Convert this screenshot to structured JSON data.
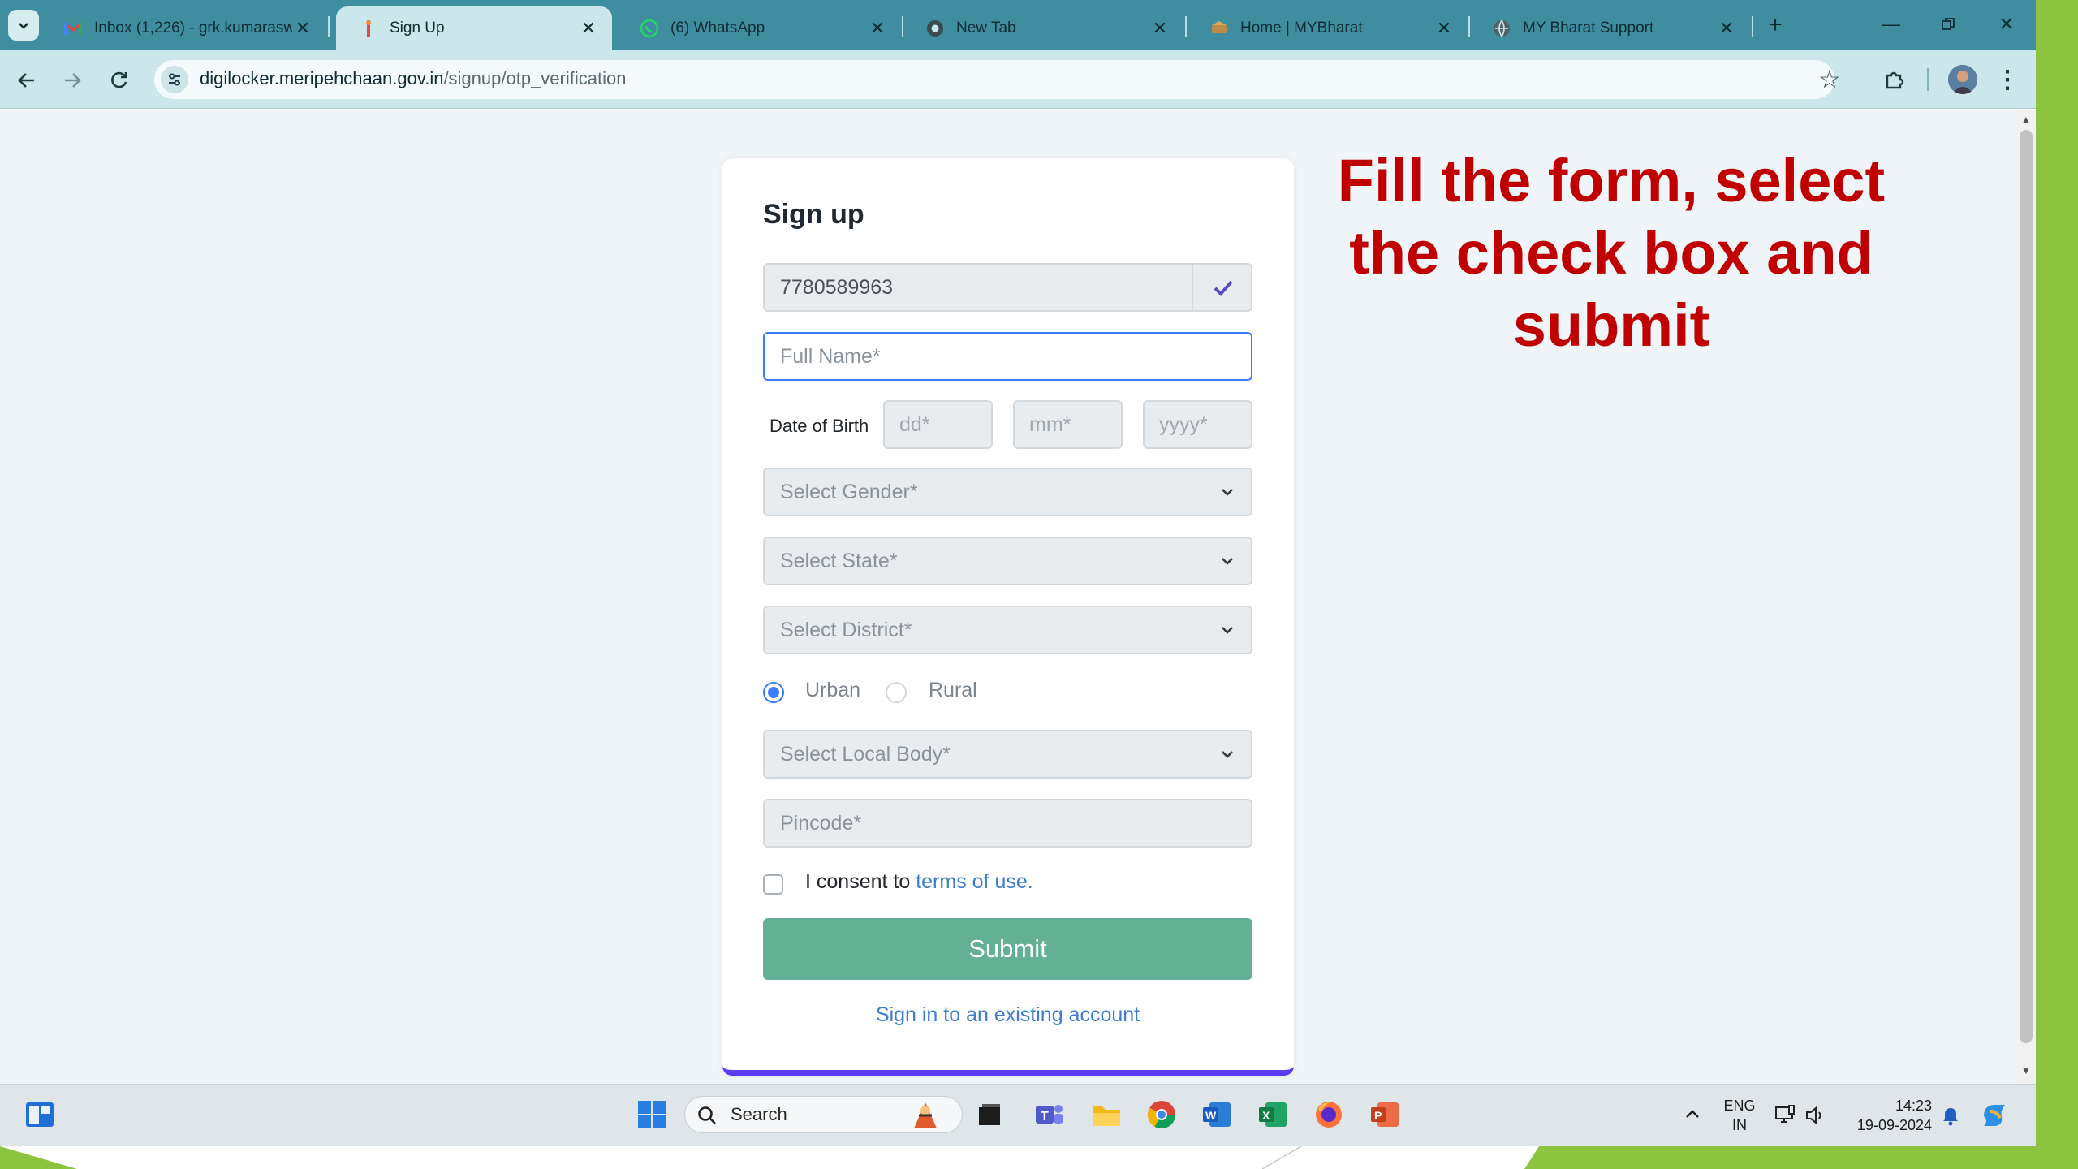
{
  "tabs": [
    {
      "title": "Inbox (1,226) - grk.kumarasw",
      "icon": "gmail-icon",
      "active": false
    },
    {
      "title": "Sign Up",
      "icon": "digilocker-icon",
      "active": true
    },
    {
      "title": "(6) WhatsApp",
      "icon": "whatsapp-icon",
      "active": false
    },
    {
      "title": "New Tab",
      "icon": "chrome-icon",
      "active": false
    },
    {
      "title": "Home | MYBharat",
      "icon": "mybharat-icon",
      "active": false
    },
    {
      "title": "MY Bharat Support",
      "icon": "globe-icon",
      "active": false
    }
  ],
  "address_bar": {
    "host": "digilocker.meripehchaan.gov.in",
    "path": "/signup/otp_verification"
  },
  "form": {
    "title": "Sign up",
    "mobile_value": "7780589963",
    "full_name_placeholder": "Full Name*",
    "dob_label": "Date of Birth",
    "dob_dd_placeholder": "dd*",
    "dob_mm_placeholder": "mm*",
    "dob_yyyy_placeholder": "yyyy*",
    "gender_placeholder": "Select Gender*",
    "state_placeholder": "Select State*",
    "district_placeholder": "Select District*",
    "area_options": [
      "Urban",
      "Rural"
    ],
    "area_selected": "Urban",
    "local_body_placeholder": "Select Local Body*",
    "pincode_placeholder": "Pincode*",
    "consent_prefix": "I consent to",
    "consent_link": "terms of use.",
    "consent_checked": false,
    "submit_label": "Submit",
    "signin_link": "Sign in to an existing account"
  },
  "instruction": "Fill the form, select the check box and submit",
  "taskbar": {
    "search_label": "Search",
    "language": "ENG",
    "region": "IN",
    "time": "14:23",
    "date": "19-09-2024"
  },
  "colors": {
    "tabstrip": "#3f8e9f",
    "toolbar": "#cbe7ec",
    "submit": "#63b095",
    "instruction": "#c00000",
    "link": "#3c7dd0",
    "slide_accent": "#8cc43f",
    "card_underline": "#5b3cf0"
  }
}
